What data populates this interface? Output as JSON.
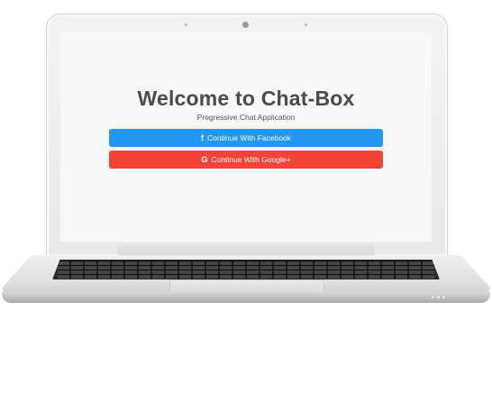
{
  "screen": {
    "title": "Welcome to Chat-Box",
    "subtitle": "Progressive Chat Application",
    "buttons": {
      "facebook": {
        "icon": "f",
        "label": "Continue With Facebook",
        "color": "#2196f3"
      },
      "google": {
        "icon": "G",
        "label": "Continue With Google+",
        "color": "#f44336"
      }
    }
  },
  "icons": {
    "facebook": "facebook-icon",
    "google": "google-icon"
  }
}
